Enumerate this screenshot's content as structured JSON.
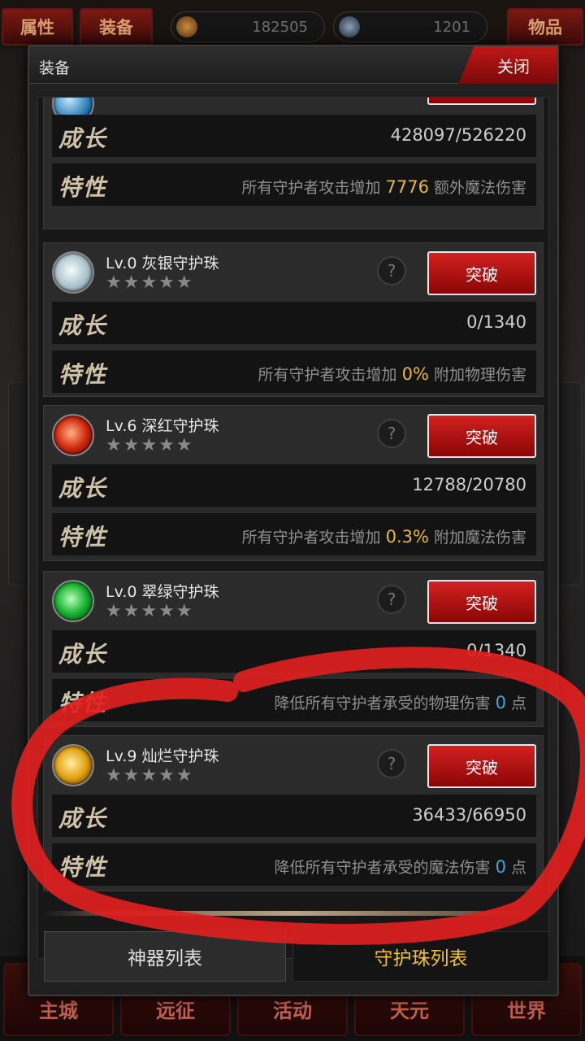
{
  "topbar": {
    "attr_tab": "属性",
    "equip_tab": "装备",
    "gold": "182505",
    "gems": "1201",
    "items_tab": "物品"
  },
  "bottom_nav": [
    "主城",
    "远征",
    "活动",
    "天元",
    "世界"
  ],
  "modal": {
    "title": "装备",
    "close_label": "关闭",
    "growth_label": "成长",
    "trait_label": "特性",
    "break_label": "突破",
    "help_label": "?",
    "stars": "★★★★★",
    "cards": [
      {
        "name": "",
        "growth": "428097/526220",
        "trait_prefix": "所有守护者攻击增加",
        "trait_value": "7776",
        "trait_suffix": "额外魔法伤害"
      },
      {
        "name": "Lv.0 灰银守护珠",
        "growth": "0/1340",
        "trait_prefix": "所有守护者攻击增加",
        "trait_value": "0%",
        "trait_suffix": "附加物理伤害"
      },
      {
        "name": "Lv.6 深红守护珠",
        "growth": "12788/20780",
        "trait_prefix": "所有守护者攻击增加",
        "trait_value": "0.3%",
        "trait_suffix": "附加魔法伤害"
      },
      {
        "name": "Lv.0 翠绿守护珠",
        "growth": "0/1340",
        "trait_prefix": "降低所有守护者承受的物理伤害",
        "trait_value": "0",
        "trait_suffix": "点"
      },
      {
        "name": "Lv.9 灿烂守护珠",
        "growth": "36433/66950",
        "trait_prefix": "降低所有守护者承受的魔法伤害",
        "trait_value": "0",
        "trait_suffix": "点"
      }
    ],
    "tab_artifacts": "神器列表",
    "tab_orbs": "守护珠列表"
  },
  "colors": {
    "accent_red": "#c01818",
    "highlight_gold": "#e6b93a",
    "highlight_blue": "#3fa8d8",
    "annotation_red": "#e02020"
  },
  "icons": [
    "gold-coin-icon",
    "skull-gem-icon",
    "help-icon",
    "orb-icon"
  ]
}
